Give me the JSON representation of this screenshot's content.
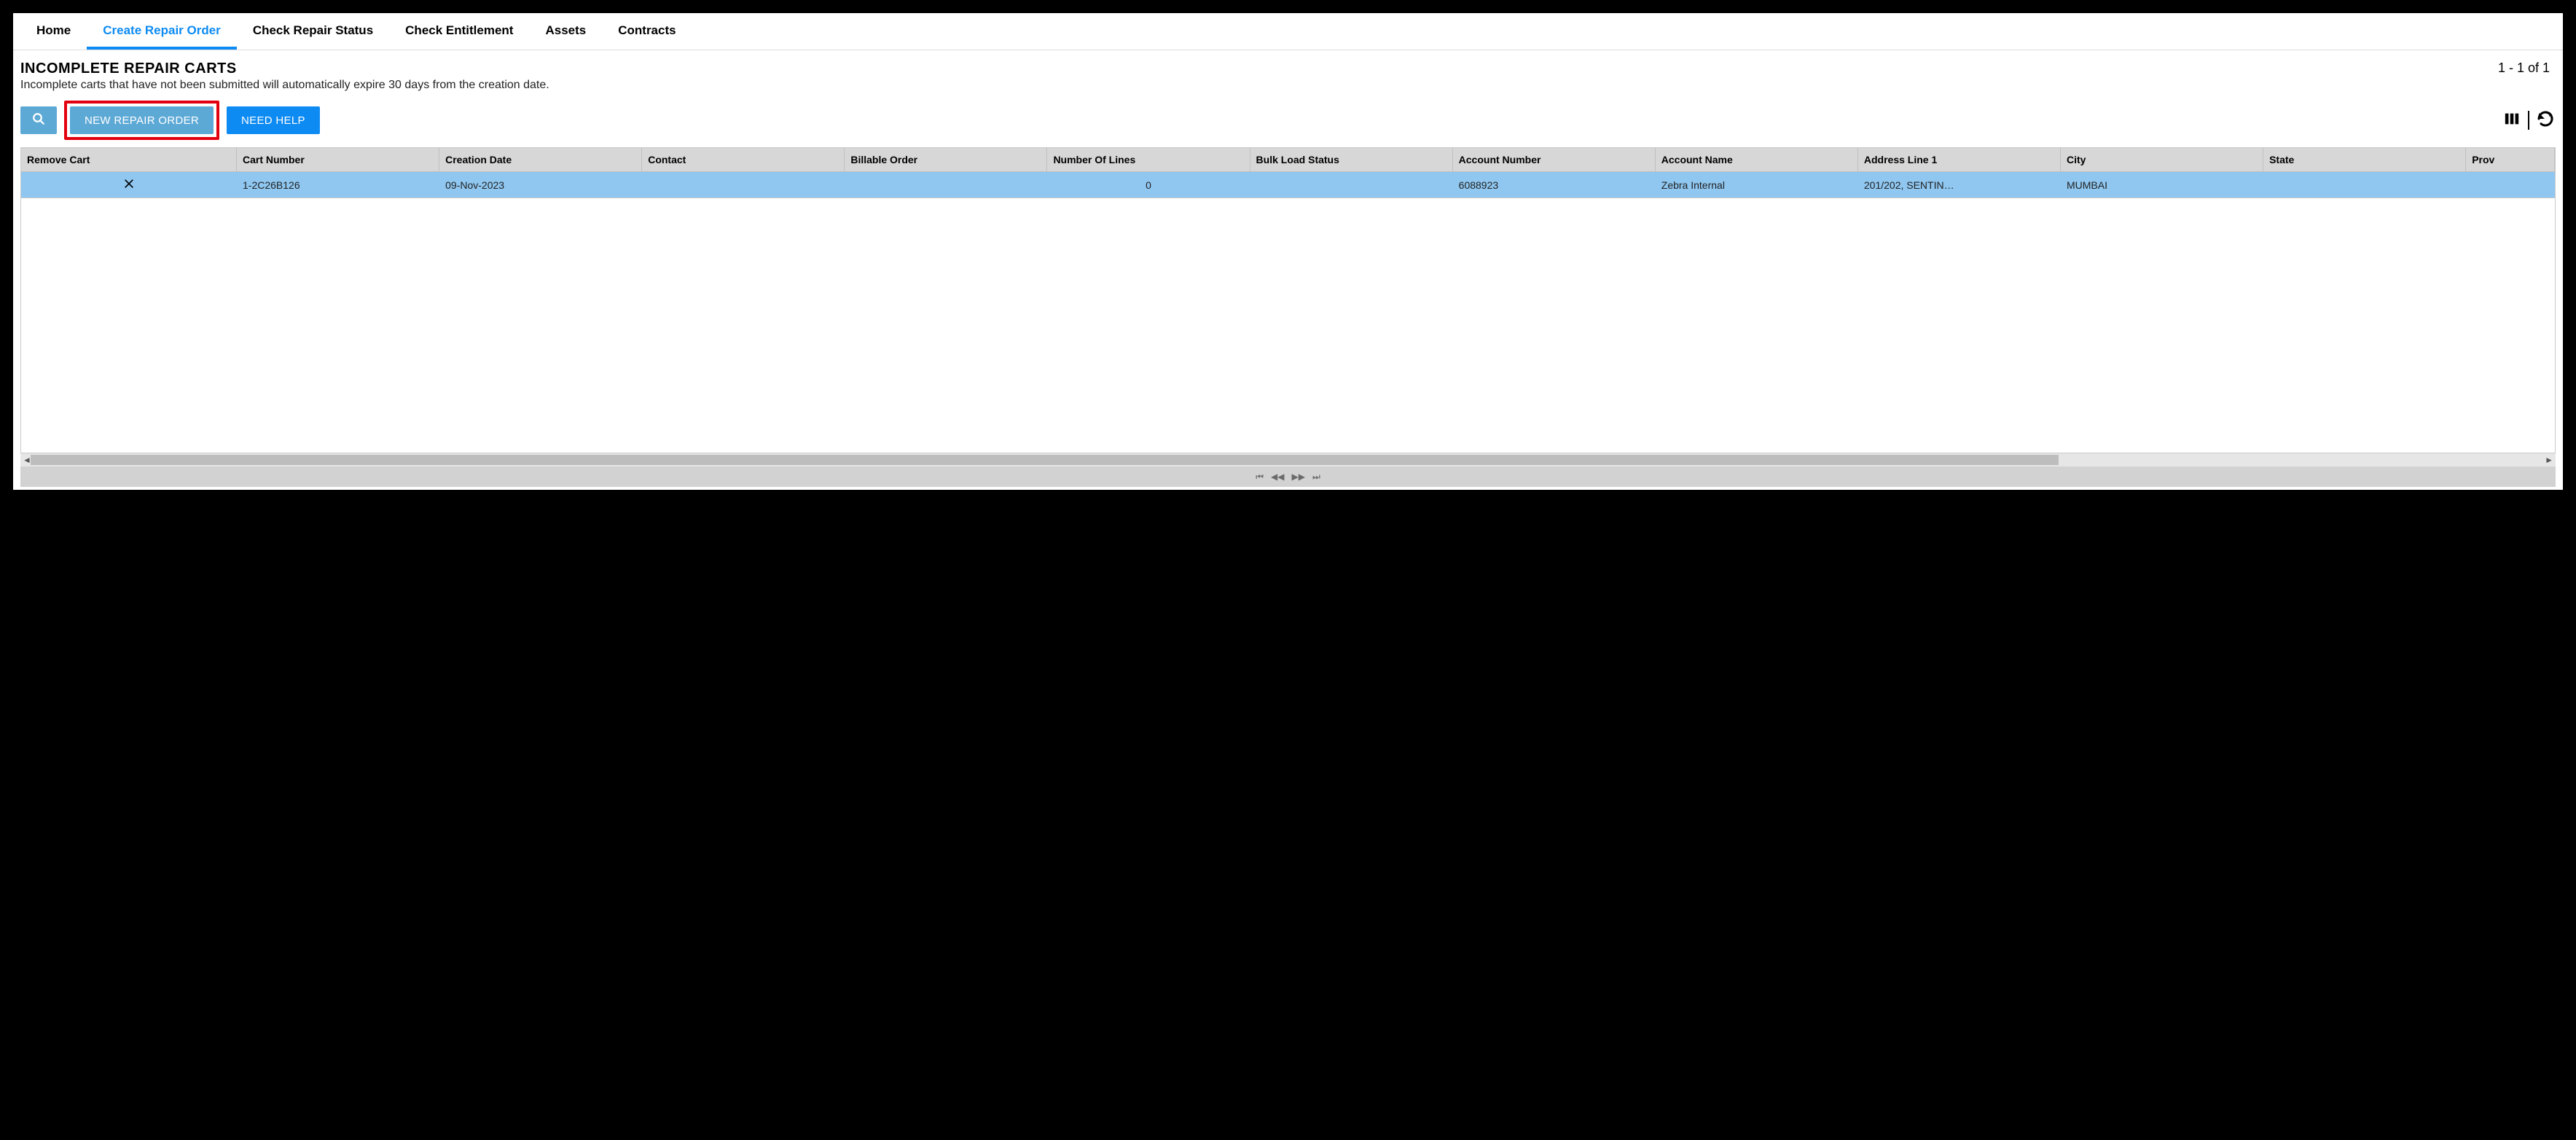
{
  "nav": {
    "tabs": [
      {
        "label": "Home",
        "active": false
      },
      {
        "label": "Create Repair Order",
        "active": true
      },
      {
        "label": "Check Repair Status",
        "active": false
      },
      {
        "label": "Check Entitlement",
        "active": false
      },
      {
        "label": "Assets",
        "active": false
      },
      {
        "label": "Contracts",
        "active": false
      }
    ]
  },
  "page": {
    "title": "INCOMPLETE REPAIR CARTS",
    "subtitle": "Incomplete carts that have not been submitted will automatically expire 30 days from the creation date.",
    "pager_info": "1 - 1 of 1"
  },
  "toolbar": {
    "new_repair_label": "NEW REPAIR ORDER",
    "need_help_label": "NEED HELP"
  },
  "table": {
    "columns": [
      "Remove Cart",
      "Cart Number",
      "Creation Date",
      "Contact",
      "Billable Order",
      "Number Of Lines",
      "Bulk Load Status",
      "Account Number",
      "Account Name",
      "Address Line 1",
      "City",
      "State",
      "Prov"
    ],
    "rows": [
      {
        "cart_number": "1-2C26B126",
        "creation_date": "09-Nov-2023",
        "contact": "",
        "billable_order": "",
        "number_of_lines": "0",
        "bulk_load_status": "",
        "account_number": "6088923",
        "account_name": "Zebra Internal",
        "address_line_1": "201/202, SENTIN…",
        "city": "MUMBAI",
        "state": "",
        "prov": ""
      }
    ]
  }
}
